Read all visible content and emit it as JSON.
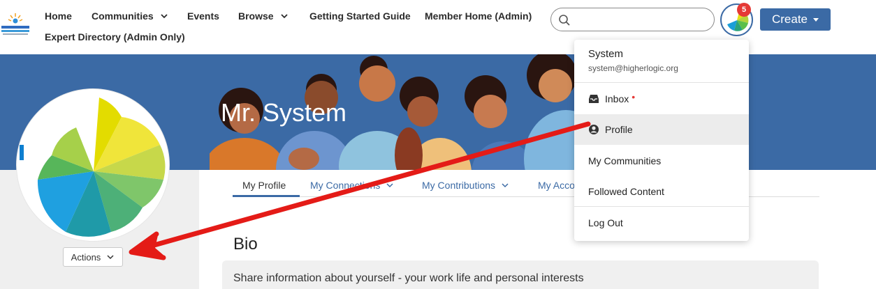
{
  "header": {
    "nav": [
      {
        "label": "Home"
      },
      {
        "label": "Communities"
      },
      {
        "label": "Events"
      },
      {
        "label": "Browse"
      },
      {
        "label": "Getting Started Guide"
      },
      {
        "label": "Member Home (Admin)"
      },
      {
        "label": "Expert Directory (Admin Only)"
      }
    ],
    "search": {
      "value": "",
      "placeholder": ""
    },
    "notification_count": "5",
    "create_label": "Create"
  },
  "profile": {
    "name": "Mr. System",
    "actions_label": "Actions",
    "tabs": [
      {
        "label": "My Profile"
      },
      {
        "label": "My Connections"
      },
      {
        "label": "My Contributions"
      },
      {
        "label": "My Acco"
      }
    ],
    "bio_heading": "Bio",
    "bio_prompt": "Share information about yourself - your work life and personal interests"
  },
  "user_menu": {
    "name": "System",
    "email": "system@higherlogic.org",
    "items": [
      {
        "label": "Inbox",
        "icon": "inbox-icon"
      },
      {
        "label": "Profile",
        "icon": "user-circle-icon"
      },
      {
        "label": "My Communities"
      },
      {
        "label": "Followed Content"
      },
      {
        "label": "Log Out"
      }
    ],
    "inbox_dot": "•"
  },
  "colors": {
    "primary": "#3b6aa5",
    "badge": "#e53935",
    "annotation_arrow": "#e41b17"
  }
}
